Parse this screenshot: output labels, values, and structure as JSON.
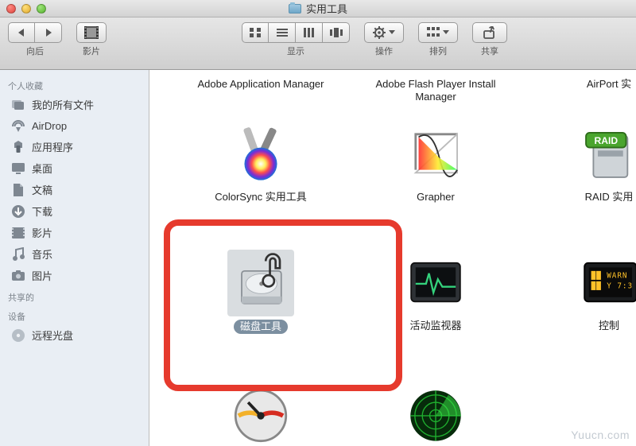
{
  "window": {
    "title": "实用工具"
  },
  "toolbar": {
    "back_label": "向后",
    "movies_label": "影片",
    "view_label": "显示",
    "action_label": "操作",
    "arrange_label": "排列",
    "share_label": "共享"
  },
  "sidebar": {
    "sections": {
      "favorites": "个人收藏",
      "shared": "共享的",
      "devices": "设备"
    },
    "items": {
      "all_files": "我的所有文件",
      "airdrop": "AirDrop",
      "applications": "应用程序",
      "desktop": "桌面",
      "documents": "文稿",
      "downloads": "下载",
      "movies": "影片",
      "music": "音乐",
      "pictures": "图片",
      "remote_disc": "远程光盘"
    }
  },
  "grid": {
    "items": {
      "adobe_app_mgr": "Adobe Application Manager",
      "adobe_flash": "Adobe Flash Player Install Manager",
      "airport": "AirPort 实",
      "colorsync": "ColorSync 实用工具",
      "grapher": "Grapher",
      "raid": "RAID 实用",
      "disk_utility": "磁盘工具",
      "activity_monitor": "活动监视器",
      "console": "控制"
    }
  },
  "watermark": "Yuucn.com"
}
